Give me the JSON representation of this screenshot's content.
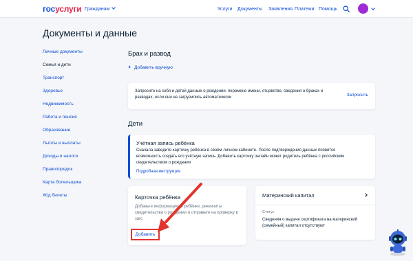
{
  "header": {
    "logo_part1": "гос",
    "logo_part2": "услуги",
    "audience": "Гражданам",
    "nav": [
      "Услуги",
      "Документы",
      "Заявления",
      "Платежи",
      "Помощь"
    ]
  },
  "page_title": "Документы и данные",
  "sidebar": {
    "items": [
      "Личные документы",
      "Семья и дети",
      "Транспорт",
      "Здоровье",
      "Недвижимость",
      "Работа и пенсия",
      "Образование",
      "Льготы и выплаты",
      "Доходы и налоги",
      "Правопорядок",
      "Карта болельщика",
      "Ж/д билеты"
    ],
    "active_index": 1
  },
  "marriage": {
    "title": "Брак и развод",
    "add_manual": "Добавить вручную",
    "request_text": "Запросите на себя и детей данные о рождении, перемене имени, отцовстве, сведения о браках и разводах, если они не загрузились автоматически",
    "request_button": "Запросить"
  },
  "children": {
    "title": "Дети",
    "info_title": "Учётная запись ребёнка",
    "info_text": "Сначала заведите карточку ребёнка в своём личном кабинете. После подтверждения данных появится возможность создать его учётную запись. Добавить карточку онлайн может родитель ребёнка с российским свидетельством о рождении",
    "info_link": "Подробная инструкция",
    "card_title": "Карточка ребёнка",
    "card_text": "Добавьте информацию о ребёнке, реквизиты свидетельства о рождении и отправьте на проверку в загс",
    "add_button": "Добавить"
  },
  "capital": {
    "title": "Материнский капитал",
    "status_label": "Статус",
    "status_value": "Сведения о выдаче сертификата на материнский (семейный) капитал отсутствуют"
  },
  "colors": {
    "accent": "#0d4cd3",
    "logo_red": "#e4264d",
    "highlight": "#e3342f",
    "avatar": "#a02bd6",
    "background": "#f4f6f9"
  },
  "icons": [
    "search-icon",
    "avatar",
    "chevron-down-icon",
    "chevron-right-icon",
    "assistant-robot-icon"
  ]
}
